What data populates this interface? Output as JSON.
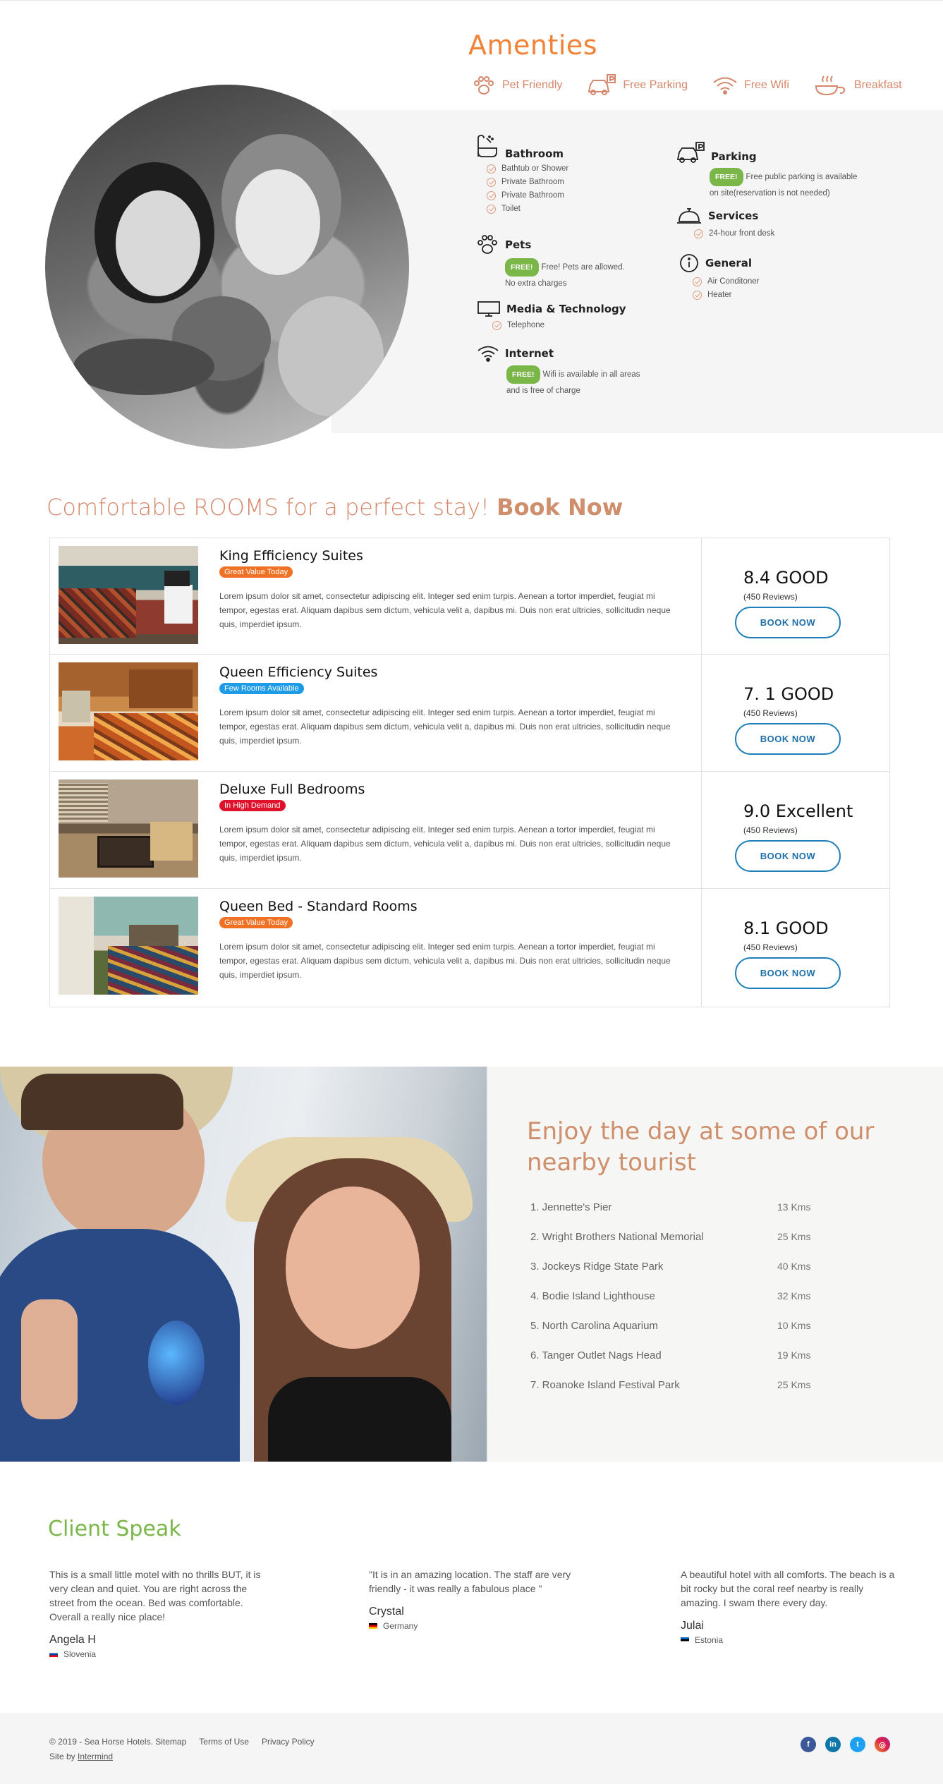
{
  "amenities": {
    "title": "Amenties",
    "top_items": [
      {
        "label": "Pet Friendly",
        "icon": "paw-icon"
      },
      {
        "label": "Free Parking",
        "icon": "car-parking-icon"
      },
      {
        "label": "Free Wifi",
        "icon": "wifi-icon"
      },
      {
        "label": "Breakfast",
        "icon": "breakfast-icon"
      }
    ],
    "bathroom": {
      "title": "Bathroom",
      "items": [
        "Bathtub or Shower",
        "Private Bathroom",
        "Private Bathroom",
        "Toilet"
      ]
    },
    "pets": {
      "title": "Pets",
      "badge": "FREE!",
      "note1": "Free! Pets are allowed.",
      "note2": "No extra charges"
    },
    "media": {
      "title": "Media & Technology",
      "items": [
        "Telephone"
      ]
    },
    "internet": {
      "title": "Internet",
      "badge": "FREE!",
      "note1": "Wifi is available in all areas",
      "note2": "and is free of charge"
    },
    "parking": {
      "title": "Parking",
      "badge": "FREE!",
      "note1": "Free public parking is available",
      "note2": "on site(reservation is not needed)"
    },
    "services": {
      "title": "Services",
      "items": [
        "24-hour front desk"
      ]
    },
    "general": {
      "title": "General",
      "items": [
        "Air Conditoner",
        "Heater"
      ]
    }
  },
  "rooms": {
    "title_light": "Comfortable ROOMS for a perfect stay! ",
    "title_bold": "Book Now",
    "book_label": "BOOK NOW",
    "list": [
      {
        "name": "King Efficiency Suites",
        "badge": "Great Value Today",
        "badge_color": "#f07024",
        "desc": "Lorem ipsum dolor sit amet, consectetur adipiscing elit. Integer sed enim turpis. Aenean a tortor imperdiet, feugiat mi tempor, egestas erat. Aliquam dapibus sem dictum, vehicula velit a, dapibus mi. Duis non erat ultricies, sollicitudin neque quis, imperdiet ipsum.",
        "score": "8.4 GOOD",
        "reviews": "(450 Reviews)"
      },
      {
        "name": "Queen Efficiency Suites",
        "badge": "Few Rooms Available",
        "badge_color": "#1e9be6",
        "desc": "Lorem ipsum dolor sit amet, consectetur adipiscing elit. Integer sed enim turpis. Aenean a tortor imperdiet, feugiat mi tempor, egestas erat. Aliquam dapibus sem dictum, vehicula velit a, dapibus mi. Duis non erat ultricies, sollicitudin neque quis, imperdiet ipsum.",
        "score": "7. 1 GOOD",
        "reviews": "(450 Reviews)"
      },
      {
        "name": "Deluxe Full Bedrooms",
        "badge": "In High Demand",
        "badge_color": "#e0112b",
        "desc": "Lorem ipsum dolor sit amet, consectetur adipiscing elit. Integer sed enim turpis. Aenean a tortor imperdiet, feugiat mi tempor, egestas erat. Aliquam dapibus sem dictum, vehicula velit a, dapibus mi. Duis non erat ultricies, sollicitudin neque quis, imperdiet ipsum.",
        "score": "9.0 Excellent",
        "reviews": "(450 Reviews)"
      },
      {
        "name": "Queen Bed -  Standard Rooms",
        "badge": "Great Value Today",
        "badge_color": "#f07024",
        "desc": "Lorem ipsum dolor sit amet, consectetur adipiscing elit. Integer sed enim turpis. Aenean a tortor imperdiet, feugiat mi tempor, egestas erat. Aliquam dapibus sem dictum, vehicula velit a, dapibus mi. Duis non erat ultricies, sollicitudin neque quis, imperdiet ipsum.",
        "score": "8.1 GOOD",
        "reviews": "(450 Reviews)"
      }
    ]
  },
  "tourist": {
    "title": "Enjoy the day at some of our nearby tourist",
    "places": [
      {
        "name": "1. Jennette's Pier",
        "distance": "13 Kms"
      },
      {
        "name": "2. Wright Brothers National Memorial",
        "distance": "25 Kms"
      },
      {
        "name": "3. Jockeys Ridge State Park",
        "distance": "40 Kms"
      },
      {
        "name": "4. Bodie Island Lighthouse",
        "distance": "32 Kms"
      },
      {
        "name": "5. North Carolina Aquarium",
        "distance": "10 Kms"
      },
      {
        "name": "6. Tanger Outlet Nags Head",
        "distance": "19 Kms"
      },
      {
        "name": "7. Roanoke Island Festival Park",
        "distance": "25 Kms"
      }
    ]
  },
  "clients": {
    "title": "Client Speak",
    "list": [
      {
        "text": "This is a small little motel with no thrills BUT, it is very clean and quiet. You are right across the street from the ocean. Bed was comfortable. Overall a really nice place!",
        "name": "Angela H",
        "country": "Slovenia"
      },
      {
        "text": "\"It is in an amazing location. The staff are very friendly - it was really a fabulous place \"",
        "name": "Crystal",
        "country": "Germany"
      },
      {
        "text": "A beautiful hotel with all comforts. The beach is a bit rocky but the coral reef nearby is really amazing. I swam there every day.",
        "name": "Julai",
        "country": "Estonia"
      }
    ]
  },
  "footer": {
    "copyright": "© 2019 - Sea Horse Hotels. Sitemap",
    "terms": "Terms of Use",
    "privacy": "Privacy Policy",
    "site_by": "Site by ",
    "site_by_link": "Intermind",
    "socials": [
      {
        "icon": "facebook-icon",
        "glyph": "f",
        "color": "#3b5998"
      },
      {
        "icon": "linkedin-icon",
        "glyph": "in",
        "color": "#0e76a8"
      },
      {
        "icon": "twitter-icon",
        "glyph": "t",
        "color": "#1da1f2"
      },
      {
        "icon": "instagram-icon",
        "glyph": "◎",
        "color": "#d6249f"
      }
    ]
  }
}
